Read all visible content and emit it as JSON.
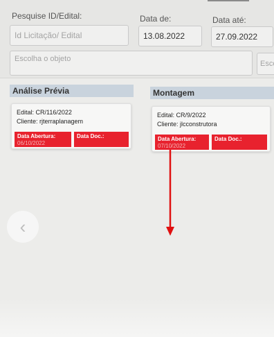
{
  "filters": {
    "search_label": "Pesquise ID/Edital:",
    "search_placeholder": "Id Licitação/ Edital",
    "date_from_label": "Data de:",
    "date_from_value": "13.08.2022",
    "date_to_label": "Data até:",
    "date_to_value": "27.09.2022",
    "object_placeholder": "Escolha o objeto",
    "partial_select_text": "Esco"
  },
  "columns": [
    {
      "title": "Análise Prévia",
      "cards": [
        {
          "edital": "Edital: CR/116/2022",
          "cliente": "Cliente: rjterraplanagem",
          "tag_opening_label": "Data Abertura:",
          "tag_opening_value": "06/10/2022",
          "tag_doc_label": "Data Doc.:"
        }
      ]
    },
    {
      "title": "Montagem",
      "cards": [
        {
          "edital": "Edital: CR/9/2022",
          "cliente": "Cliente: jlcconstrutora",
          "tag_opening_label": "Data Abertura:",
          "tag_opening_value": "07/10/2022",
          "tag_doc_label": "Data Doc.:"
        }
      ]
    }
  ],
  "nav": {
    "back_icon": "chevron-left-icon"
  },
  "colors": {
    "tag_red": "#e8222e",
    "column_header": "#c9d3dd",
    "arrow": "#e01010"
  }
}
